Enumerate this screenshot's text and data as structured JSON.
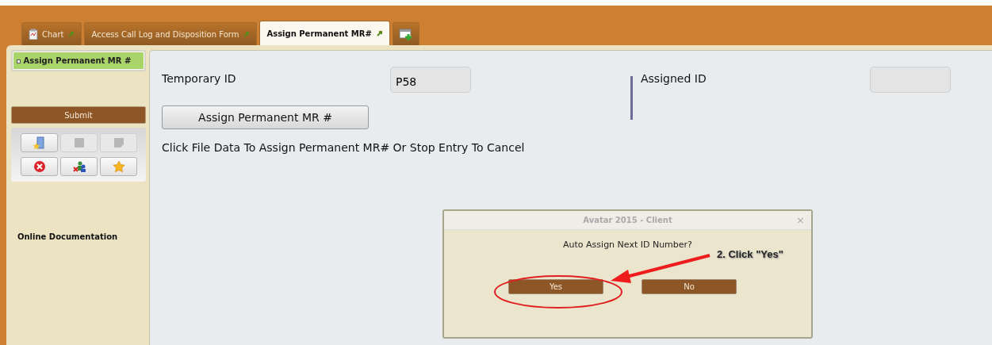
{
  "tabs": [
    {
      "label": "Chart",
      "selected": false,
      "kind": "chart"
    },
    {
      "label": "Access Call Log and Disposition Form",
      "selected": false,
      "kind": "form"
    },
    {
      "label": "Assign Permanent MR#",
      "selected": true,
      "kind": "form"
    }
  ],
  "sidebar": {
    "items": [
      {
        "label": "Assign Permanent MR #",
        "selected": true
      }
    ],
    "submit_button": "Submit",
    "tools": [
      {
        "kind": "open",
        "disabled": false
      },
      {
        "kind": "square",
        "disabled": true
      },
      {
        "kind": "note",
        "disabled": true
      },
      {
        "kind": "stop",
        "disabled": false
      },
      {
        "kind": "people",
        "disabled": false
      },
      {
        "kind": "star",
        "disabled": false
      }
    ],
    "link": "Online Documentation"
  },
  "form": {
    "temporary_id": {
      "label": "Temporary ID",
      "value": "P58"
    },
    "assigned_id": {
      "label": "Assigned ID"
    },
    "assign_button": "Assign Permanent MR #",
    "instruction": "Click File Data To Assign Permanent MR# Or Stop Entry To Cancel"
  },
  "dialog": {
    "title": "Avatar 2015 - Client",
    "close": "×",
    "message": "Auto Assign Next ID Number?",
    "buttons": [
      "Yes",
      "No"
    ]
  },
  "annotation": {
    "text": "2. Click \"Yes\""
  }
}
